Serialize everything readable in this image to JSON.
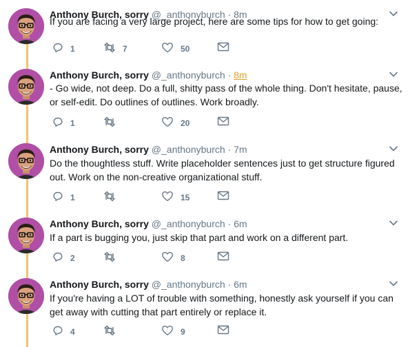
{
  "tweets": [
    {
      "name": "Anthony Burch, sorry",
      "handle": "@_anthonyburch",
      "dot": "·",
      "time": "8m",
      "highlight": false,
      "text": "If you are facing a very large project, here are some tips for how to get going:",
      "replies": "1",
      "retweets": "7",
      "likes": "50"
    },
    {
      "name": "Anthony Burch, sorry",
      "handle": "@_anthonyburch",
      "dot": "·",
      "time": "8m",
      "highlight": true,
      "text": "- Go wide, not deep. Do a full, shitty pass of the whole thing. Don't hesitate, pause, or self-edit. Do outlines of outlines. Work broadly.",
      "replies": "1",
      "retweets": "",
      "likes": "20"
    },
    {
      "name": "Anthony Burch, sorry",
      "handle": "@_anthonyburch",
      "dot": "·",
      "time": "7m",
      "highlight": false,
      "text": "Do the thoughtless stuff. Write placeholder sentences just to get structure figured out. Work on the non-creative organizational stuff.",
      "replies": "1",
      "retweets": "",
      "likes": "15"
    },
    {
      "name": "Anthony Burch, sorry",
      "handle": "@_anthonyburch",
      "dot": "·",
      "time": "6m",
      "highlight": false,
      "text": "If a part is bugging you, just skip that part and work on a different part.",
      "replies": "2",
      "retweets": "",
      "likes": "8"
    },
    {
      "name": "Anthony Burch, sorry",
      "handle": "@_anthonyburch",
      "dot": "·",
      "time": "6m",
      "highlight": false,
      "text": "If you're having a LOT of trouble with something, honestly ask yourself if you can get away with cutting that part entirely or replace it.",
      "replies": "4",
      "retweets": "",
      "likes": "9"
    }
  ],
  "icons": {
    "reply": "reply-icon",
    "retweet": "retweet-icon",
    "like": "heart-icon",
    "message": "envelope-icon",
    "menu": "chevron-down-icon"
  },
  "colors": {
    "thread_line": "#f5c16c",
    "text": "#14171a",
    "secondary": "#657786",
    "highlight_time": "#e0a02a",
    "avatar_bg": "#b04fa5"
  }
}
